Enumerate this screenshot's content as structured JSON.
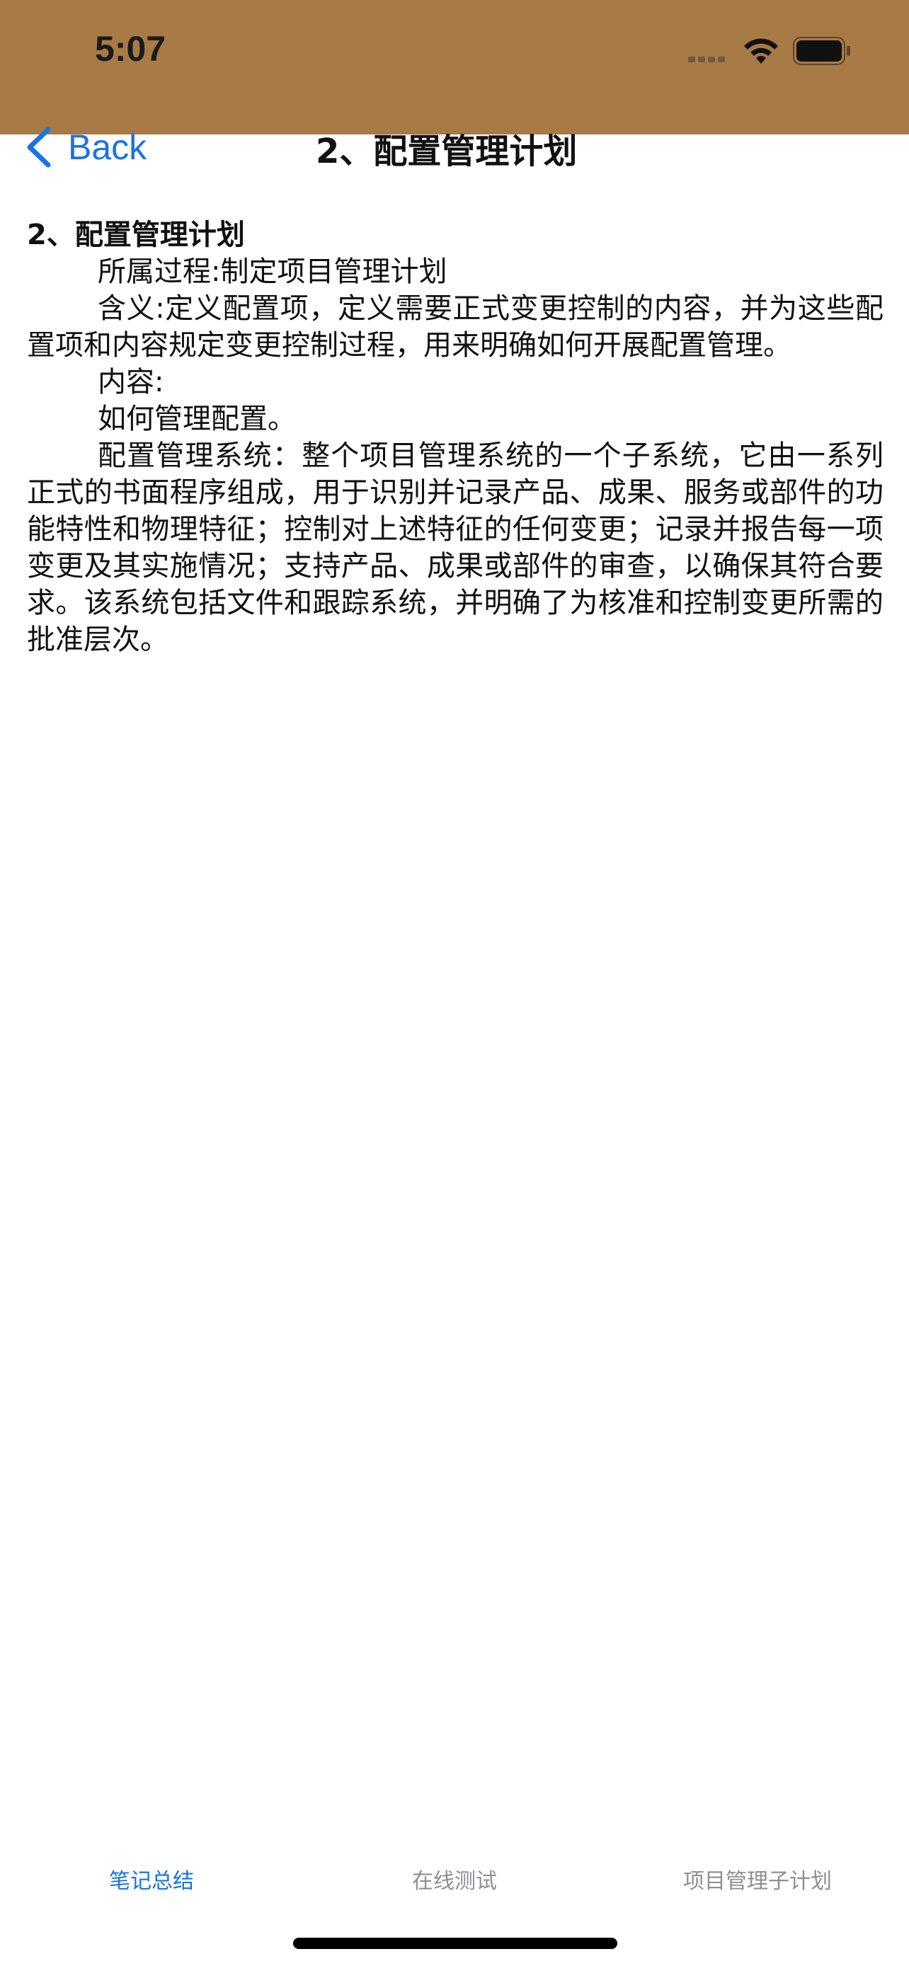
{
  "status_bar": {
    "time": "5:07",
    "icons": [
      "cellular-signal-icon",
      "wifi-icon",
      "battery-icon"
    ],
    "background_color": "#a87a45"
  },
  "nav": {
    "back_label": "Back",
    "title": "2、配置管理计划",
    "accent_color": "#1a73e8"
  },
  "content": {
    "heading": "2、配置管理计划",
    "paragraphs": [
      "所属过程:制定项目管理计划",
      "含义:定义配置项，定义需要正式变更控制的内容，并为这些配置项和内容规定变更控制过程，用来明确如何开展配置管理。",
      "内容:",
      "如何管理配置。",
      "配置管理系统：整个项目管理系统的一个子系统，它由一系列正式的书面程序组成，用于识别并记录产品、成果、服务或部件的功能特性和物理特征；控制对上述特征的任何变更；记录并报告每一项变更及其实施情况；支持产品、成果或部件的审查，以确保其符合要求。该系统包括文件和跟踪系统，并明确了为核准和控制变更所需的批准层次。"
    ]
  },
  "tabs": [
    {
      "label": "笔记总结",
      "active": true
    },
    {
      "label": "在线测试",
      "active": false
    },
    {
      "label": "项目管理子计划",
      "active": false
    }
  ]
}
